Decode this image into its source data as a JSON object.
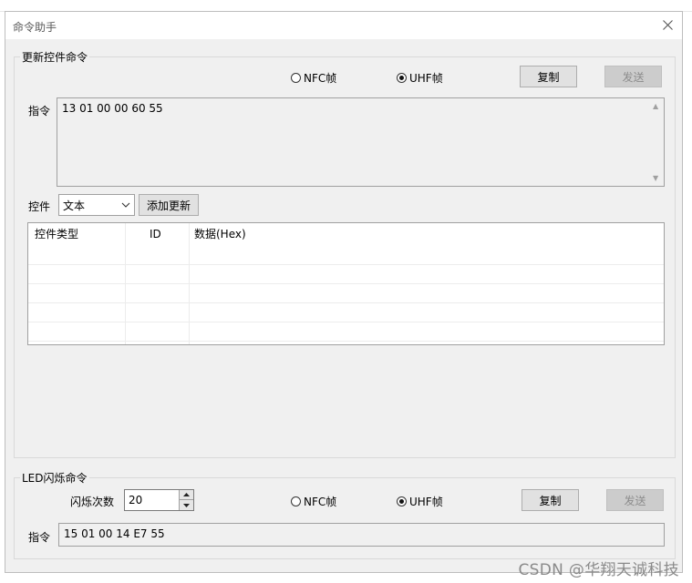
{
  "window": {
    "title": "命令助手"
  },
  "update_group": {
    "legend": "更新控件命令",
    "radio_nfc": "NFC帧",
    "radio_uhf": "UHF帧",
    "selected_frame": "UHF帧",
    "copy_label": "复制",
    "send_label": "发送",
    "command_label": "指令",
    "command_value": "13 01 00 00 60 55",
    "control_label": "控件",
    "control_type_selected": "文本",
    "add_update_label": "添加更新",
    "table": {
      "columns": [
        "控件类型",
        "ID",
        "数据(Hex)"
      ],
      "rows": []
    }
  },
  "led_group": {
    "legend": "LED闪烁命令",
    "blink_count_label": "闪烁次数",
    "blink_count_value": "20",
    "radio_nfc": "NFC帧",
    "radio_uhf": "UHF帧",
    "selected_frame": "UHF帧",
    "copy_label": "复制",
    "send_label": "发送",
    "command_label": "指令",
    "command_value": "15 01 00 14 E7 55"
  },
  "watermark": "CSDN @华翔天诚科技",
  "icons": {
    "close": "close-icon",
    "dropdown": "chevron-down-icon",
    "spin_up": "spin-up-icon",
    "spin_down": "spin-down-icon",
    "scroll_up": "scroll-up-arrow-icon",
    "scroll_down": "scroll-down-arrow-icon"
  }
}
